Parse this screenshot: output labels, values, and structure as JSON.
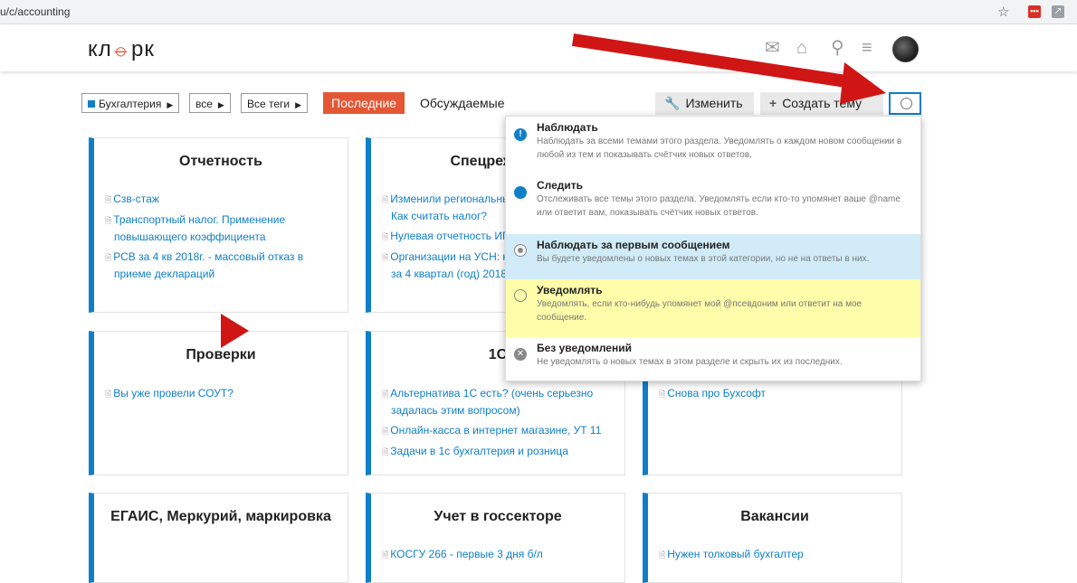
{
  "browser": {
    "url": "u/c/accounting"
  },
  "site": {
    "logo": "кл📎рк"
  },
  "nav": {
    "crumbs": [
      "Бухгалтерия",
      "все",
      "Все теги"
    ],
    "tab_latest": "Последние",
    "tab_top": "Обсуждаемые",
    "edit_label": "Изменить",
    "create_label": "Создать тему"
  },
  "cards": [
    {
      "title": "Отчетность",
      "topics": [
        "Сзв-стаж",
        "Транспортный налог. Применение повышающего коэффициента",
        "РСВ за 4 кв 2018г. - массовый отказ в приеме деклараций"
      ]
    },
    {
      "title": "Спецрежимы",
      "topics": [
        "Изменили региональные ставки по УСН. Как считать налог?",
        "Нулевая отчетность ИП на УСН доходы 6%",
        "Организации на УСН: налоговая отчетность за 4 квартал (год) 2018"
      ]
    },
    {
      "title": "Проверки",
      "topics": [
        "Вы уже провели СОУТ?"
      ]
    },
    {
      "title": "1С",
      "topics": [
        "Альтернатива 1С есть? (очень серьезно задалась этим вопросом)",
        "Онлайн-касса в интернет магазине, УТ 11",
        "Задачи в 1с бухгалтерия и розница"
      ]
    },
    {
      "title": "",
      "topics": [
        "Снова про Бухсофт"
      ]
    },
    {
      "title": "ЕГАИС, Меркурий, маркировка",
      "topics": []
    },
    {
      "title": "Учет в госсекторе",
      "topics": [
        "КОСГУ 266 - первые 3 дня б/л"
      ]
    },
    {
      "title": "Вакансии",
      "topics": [
        "Нужен толковый бухгалтер"
      ]
    }
  ],
  "dropdown": {
    "options": [
      {
        "title": "Наблюдать",
        "desc": "Наблюдать за всеми темами этого раздела. Уведомлять о каждом новом сообщении в любой из тем и показывать счётчик новых ответов."
      },
      {
        "title": "Следить",
        "desc": "Отслеживать все темы этого раздела. Уведомлять если кто-то упомянет ваше @name или ответит вам, показывать счётчик новых ответов."
      },
      {
        "title": "Наблюдать за первым сообщением",
        "desc": "Вы будете уведомлены о новых темах в этой категории, но не на ответы в них."
      },
      {
        "title": "Уведомлять",
        "desc": "Уведомлять, если кто-нибудь упомянет мой @псевдоним или ответит на мое сообщение."
      },
      {
        "title": "Без уведомлений",
        "desc": "Не уведомлять о новых темах в этом разделе и скрыть их из последних."
      }
    ]
  },
  "colors": {
    "accent": "#0f7fc8",
    "brand": "#e45735",
    "annotation": "#d01515"
  }
}
